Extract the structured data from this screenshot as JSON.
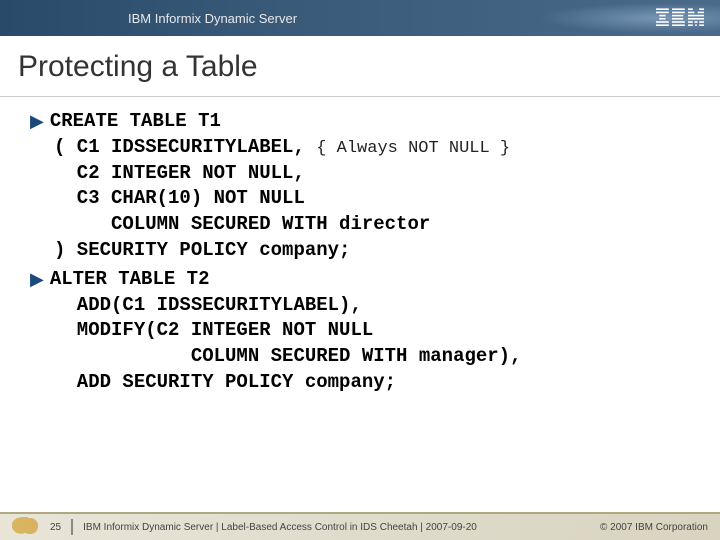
{
  "header": {
    "title": "IBM Informix Dynamic Server",
    "logo": "IBM"
  },
  "slide": {
    "title": "Protecting a Table"
  },
  "code": {
    "block1": {
      "line1": "CREATE TABLE T1",
      "line2a": "( C1 IDSSECURITYLABEL, ",
      "line2b": "{ Always NOT NULL }",
      "line3": "  C2 INTEGER NOT NULL,",
      "line4": "  C3 CHAR(10) NOT NULL",
      "line5": "     COLUMN SECURED WITH director",
      "line6": ") SECURITY POLICY company;"
    },
    "block2": {
      "line1": "ALTER TABLE T2",
      "line2": "  ADD(C1 IDSSECURITYLABEL),",
      "line3": "  MODIFY(C2 INTEGER NOT NULL",
      "line4": "            COLUMN SECURED WITH manager),",
      "line5": "  ADD SECURITY POLICY company;"
    }
  },
  "footer": {
    "page": "25",
    "text": "IBM Informix Dynamic Server  |  Label-Based Access Control in IDS Cheetah | 2007-09-20",
    "copyright": "© 2007 IBM Corporation"
  }
}
